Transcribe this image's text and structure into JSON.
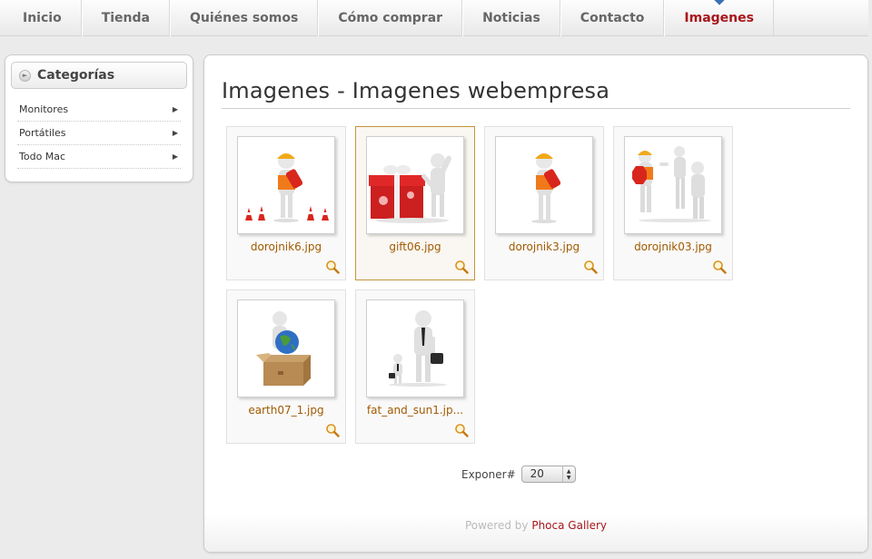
{
  "nav": {
    "items": [
      "Inicio",
      "Tienda",
      "Quiénes somos",
      "Cómo comprar",
      "Noticias",
      "Contacto",
      "Imagenes"
    ],
    "active_index": 6
  },
  "sidebar": {
    "title": "Categorías",
    "items": [
      {
        "label": "Monitores"
      },
      {
        "label": "Portátiles"
      },
      {
        "label": "Todo Mac"
      }
    ]
  },
  "main": {
    "title": "Imagenes - Imagenes webempresa",
    "images": [
      {
        "filename": "dorojnik6.jpg",
        "icon": "worker-cones-image"
      },
      {
        "filename": "gift06.jpg",
        "icon": "gift-image"
      },
      {
        "filename": "dorojnik3.jpg",
        "icon": "worker-image"
      },
      {
        "filename": "dorojnik03.jpg",
        "icon": "stop-sign-image"
      },
      {
        "filename": "earth07_1.jpg",
        "icon": "earth-box-image"
      },
      {
        "filename": "fat_and_sun1.jp...",
        "icon": "businessman-child-image"
      }
    ],
    "selected_index": 1,
    "pager": {
      "label": "Exponer#",
      "value": "20"
    },
    "footer": {
      "prefix": "Powered by",
      "link": "Phoca Gallery"
    }
  },
  "colors": {
    "accent": "#a8161b",
    "link": "#a15a00",
    "selected_border": "#c4953f"
  }
}
